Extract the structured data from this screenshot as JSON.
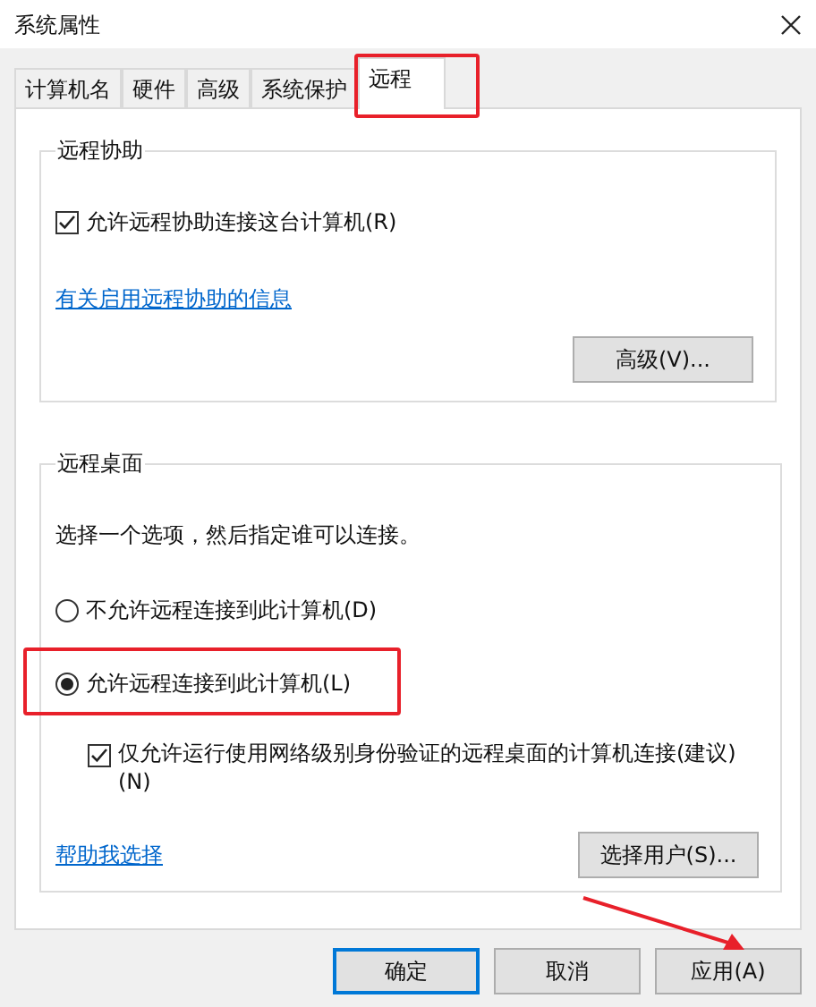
{
  "window": {
    "title": "系统属性"
  },
  "tabs": [
    {
      "label": "计算机名",
      "selected": false,
      "highlighted": false
    },
    {
      "label": "硬件",
      "selected": false,
      "highlighted": false
    },
    {
      "label": "高级",
      "selected": false,
      "highlighted": false
    },
    {
      "label": "系统保护",
      "selected": false,
      "highlighted": false
    },
    {
      "label": "远程",
      "selected": true,
      "highlighted": true
    }
  ],
  "remote_assistance": {
    "title": "远程协助",
    "checkbox": {
      "label": "允许远程协助连接这台计算机(R)",
      "checked": true
    },
    "link": "有关启用远程协助的信息",
    "button": "高级(V)..."
  },
  "remote_desktop": {
    "title": "远程桌面",
    "instruction": "选择一个选项，然后指定谁可以连接。",
    "options": [
      {
        "label": "不允许远程连接到此计算机(D)",
        "selected": false,
        "highlighted": false
      },
      {
        "label": "允许远程连接到此计算机(L)",
        "selected": true,
        "highlighted": true
      }
    ],
    "checkbox": {
      "label": "仅允许运行使用网络级别身份验证的远程桌面的计算机连接(建议)(N)",
      "checked": true
    },
    "link": "帮助我选择",
    "button": "选择用户(S)..."
  },
  "buttons": [
    {
      "label": "确定",
      "default": true,
      "pointed_at": false
    },
    {
      "label": "取消",
      "default": false,
      "pointed_at": false
    },
    {
      "label": "应用(A)",
      "default": false,
      "pointed_at": true
    }
  ]
}
